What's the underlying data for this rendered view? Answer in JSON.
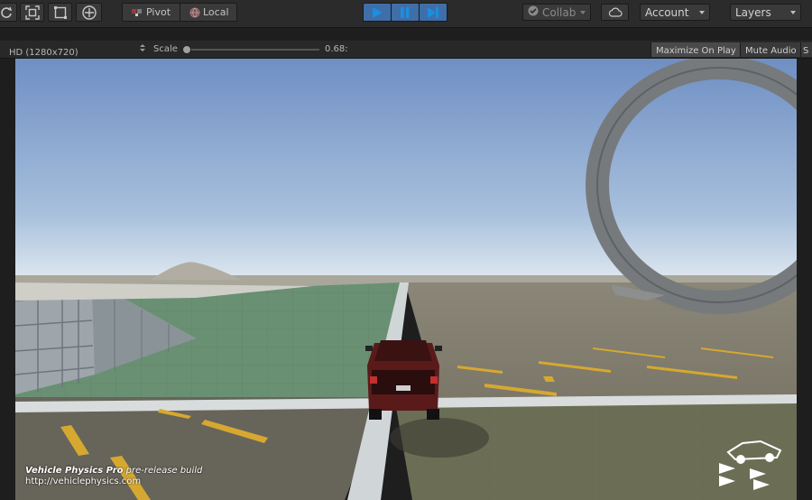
{
  "toolbar": {
    "pivot_label": "Pivot",
    "local_label": "Local",
    "collab_label": "Collab",
    "account_label": "Account",
    "layers_label": "Layers",
    "tools": [
      "rotate-tool-icon",
      "scale-tool-icon",
      "rect-tool-icon",
      "transform-tool-icon"
    ]
  },
  "gameview": {
    "resolution": "HD (1280x720)",
    "scale_label": "Scale",
    "scale_value": "0.68:",
    "scale_fraction": 0.0,
    "maximize_on_play": "Maximize On Play",
    "mute_audio": "Mute Audio",
    "stats_partial": "S"
  },
  "overlay": {
    "title": "Vehicle Physics Pro",
    "subtitle": " pre-release build",
    "url": "http://vehiclephysics.com"
  },
  "colors": {
    "play_active": "#3f6ea8",
    "sky_top": "#6f8fc4",
    "sky_horizon": "#d9e4ee"
  }
}
